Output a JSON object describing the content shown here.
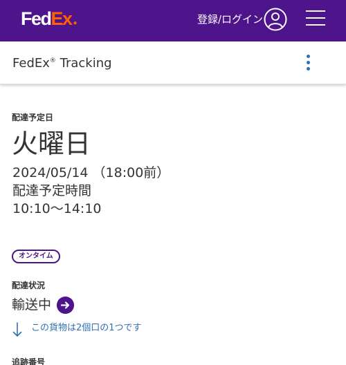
{
  "header": {
    "logo_primary": "Fed",
    "logo_accent": "Ex",
    "logo_dot": "●",
    "login_label": "登録/ログイン",
    "avatar_icon": "user-circle-icon",
    "menu_icon": "hamburger-icon",
    "brand_color": "#4d148c",
    "accent_color": "#ff6200"
  },
  "subheader": {
    "title": "FedEx",
    "registered": "®",
    "title_suffix": " Tracking",
    "more_icon": "kebab-menu-icon"
  },
  "delivery": {
    "label": "配達予定日",
    "day": "火曜日",
    "date": "2024/05/14 （18:00前）",
    "window_label": "配達予定時間",
    "window_time": "10:10〜14:10"
  },
  "status_badge": "オンタイム",
  "shipment": {
    "status_label": "配達状況",
    "status": "輸送中",
    "status_button_icon": "arrow-right-circle-icon",
    "package_icon": "arrow-down-icon",
    "package_text": "この貨物は2個口の1つです",
    "link_color": "#2f6fb3"
  },
  "tracking": {
    "label": "追跡番号"
  }
}
